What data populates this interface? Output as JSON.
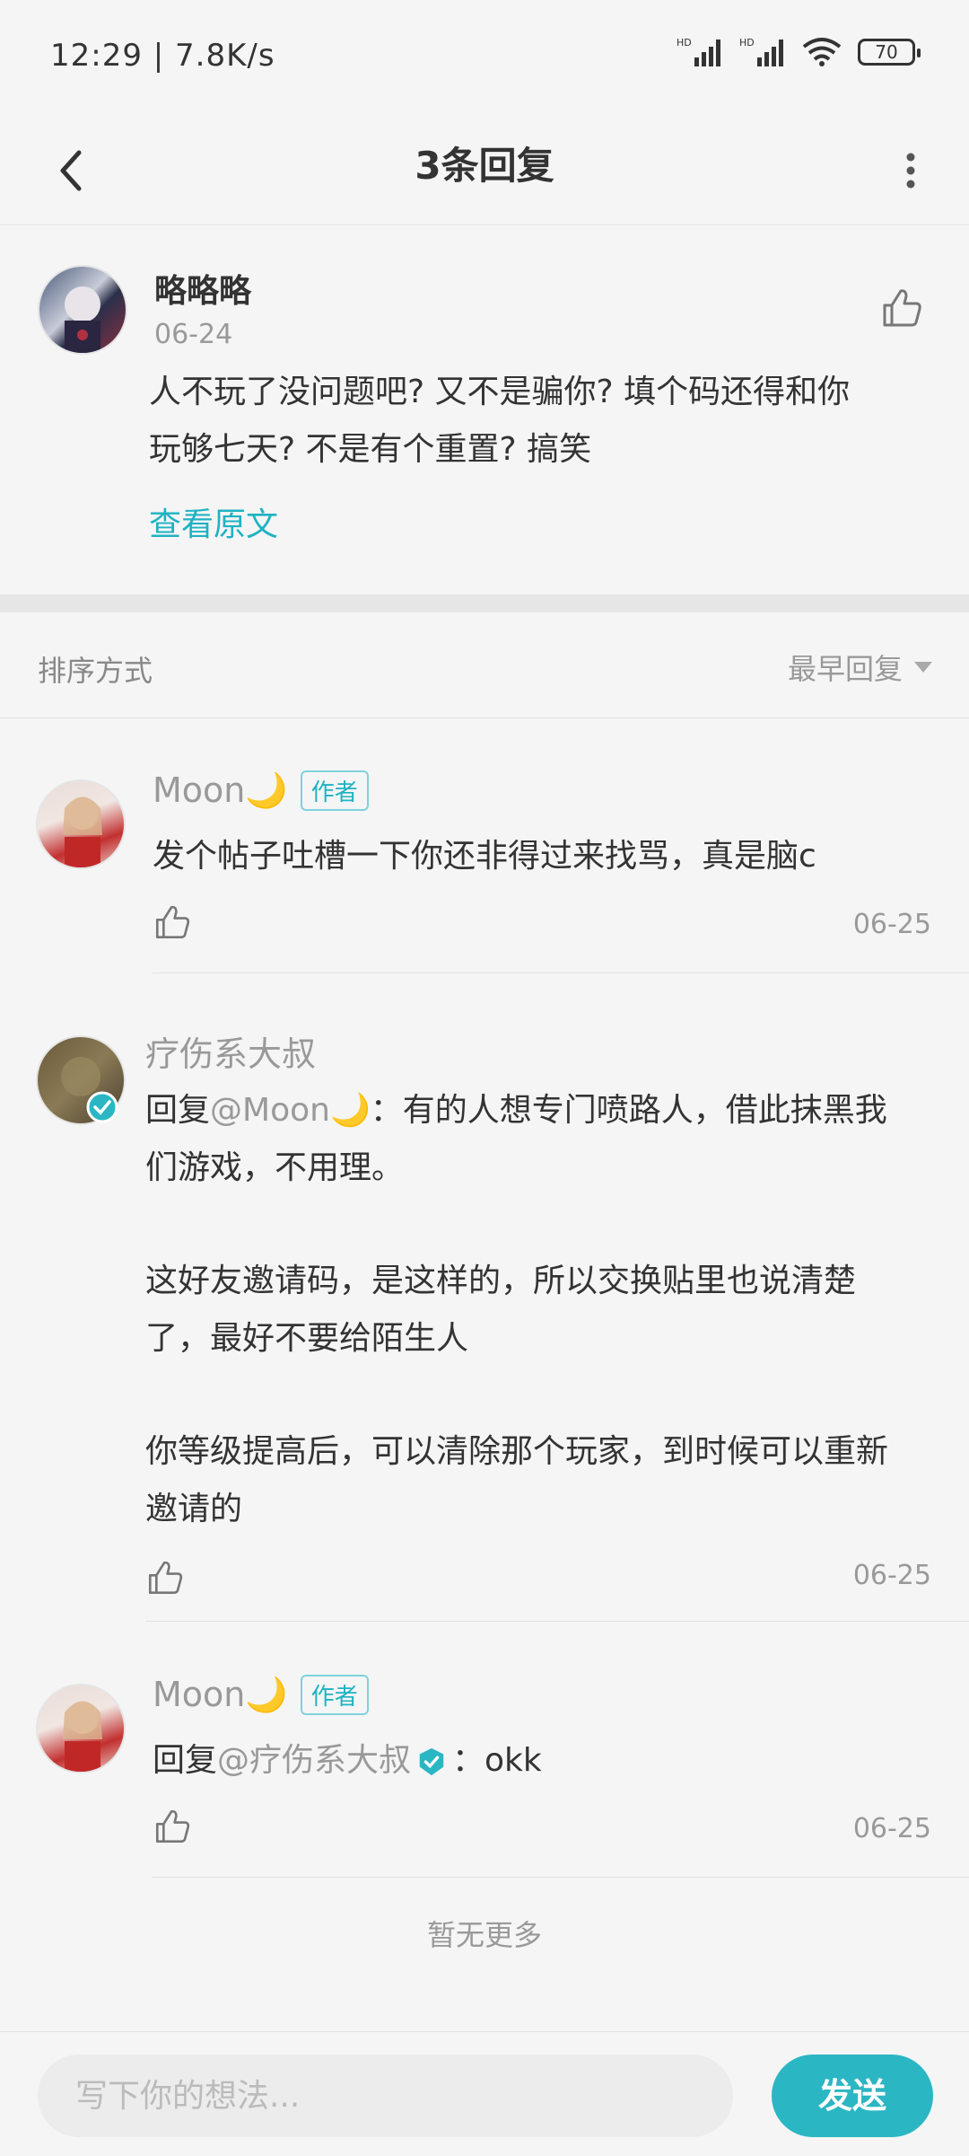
{
  "status_bar": {
    "time": "12:29 | 7.8K/s",
    "battery": "70"
  },
  "app_bar": {
    "title": "3条回复"
  },
  "main_comment": {
    "author": "略略略",
    "date": "06-24",
    "content_line1": "人不玩了没问题吧? 又不是骗你? 填个码还得和你",
    "content_line2": "玩够七天? 不是有个重置? 搞笑",
    "view_original": "查看原文"
  },
  "sort": {
    "label": "排序方式",
    "selected": "最早回复"
  },
  "replies": [
    {
      "author": "Moon🌙",
      "badge": "作者",
      "content": "发个帖子吐槽一下你还非得过来找骂，真是脑c",
      "date": "06-25"
    },
    {
      "author": "疗伤系大叔",
      "reply_prefix": "回复",
      "mention": "@Moon🌙",
      "content_rest": "：有的人想专门喷路人，借此抹黑我",
      "line2": "们游戏，不用理。",
      "para2_line1": "这好友邀请码，是这样的，所以交换贴里也说清楚",
      "para2_line2": "了，最好不要给陌生人",
      "para3_line1": "你等级提高后，可以清除那个玩家，到时候可以重新",
      "para3_line2": "邀请的",
      "date": "06-25"
    },
    {
      "author": "Moon🌙",
      "badge": "作者",
      "reply_prefix": "回复",
      "mention": "@疗伤系大叔",
      "content_rest": "：okk",
      "date": "06-25"
    }
  ],
  "no_more": "暂无更多",
  "bottom_bar": {
    "placeholder": "写下你的想法...",
    "send": "发送"
  },
  "colors": {
    "accent": "#1fb2c2",
    "send_bg": "#2bb6c4",
    "muted": "#999999"
  }
}
